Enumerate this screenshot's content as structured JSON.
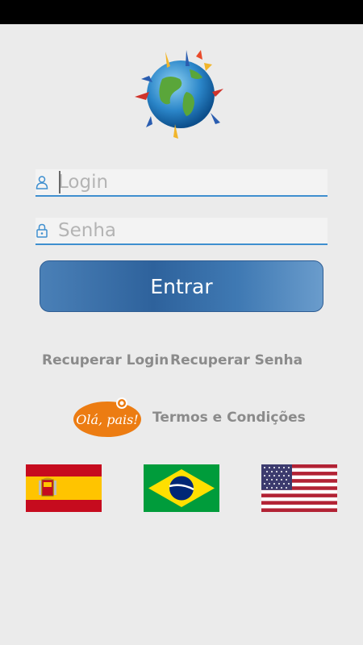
{
  "login": {
    "username_placeholder": "Login",
    "password_placeholder": "Senha",
    "submit_label": "Entrar"
  },
  "links": {
    "recover_login": "Recuperar Login",
    "recover_password": "Recuperar Senha",
    "terms": "Termos e Condições"
  },
  "badge": {
    "text": "Olá, pais!"
  },
  "languages": [
    "spain-flag",
    "brazil-flag",
    "usa-flag"
  ],
  "colors": {
    "accent": "#3f8fcf",
    "button": "#3a6fa9",
    "badge": "#ec7c12",
    "link_text": "#8b8b8b",
    "background": "#ebebeb"
  }
}
